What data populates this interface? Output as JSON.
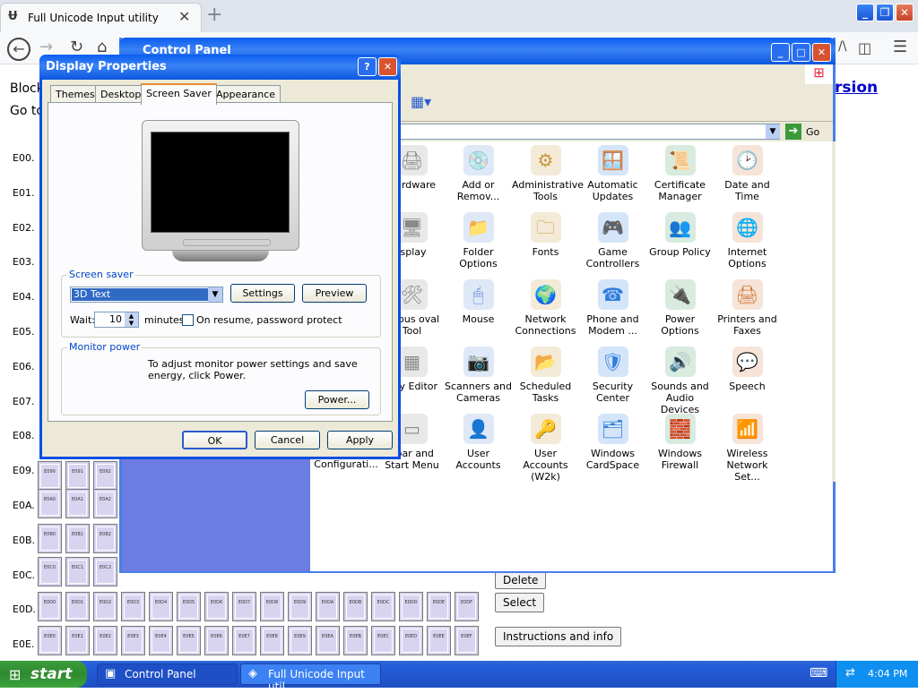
{
  "browser": {
    "tab_title": "Full Unicode Input utility",
    "tab_close": "✕",
    "new_tab": "+",
    "address_right": "/\\"
  },
  "page": {
    "left_texts": [
      "Block",
      "Go to"
    ],
    "link_right": "rsion",
    "row_labels": [
      "E00.",
      "E01.",
      "E02.",
      "E03.",
      "E04.",
      "E05.",
      "E06.",
      "E07.",
      "E08.",
      "E09.",
      "E0A.",
      "E0B.",
      "E0C.",
      "E0D.",
      "E0E."
    ],
    "cells_row_e09": [
      "E090",
      "E091",
      "E092"
    ],
    "cells_row_e0a": [
      "E0A0",
      "E0A1",
      "E0A2"
    ],
    "cells_row_e0b": [
      "E0B0",
      "E0B1",
      "E0B2"
    ],
    "cells_row_e0c": [
      "E0C0",
      "E0C1",
      "E0C2"
    ],
    "cells_row_e0d": [
      "E0D0",
      "E0D1",
      "E0D2",
      "E0D3",
      "E0D4",
      "E0D5",
      "E0D6",
      "E0D7",
      "E0D8",
      "E0D9",
      "E0DA",
      "E0DB",
      "E0DC",
      "E0DD",
      "E0DE",
      "E0DF"
    ],
    "cells_row_e0e": [
      "E0E0",
      "E0E1",
      "E0E2",
      "E0E3",
      "E0E4",
      "E0E5",
      "E0E6",
      "E0E7",
      "E0E8",
      "E0E9",
      "E0EA",
      "E0EB",
      "E0EC",
      "E0ED",
      "E0EE",
      "E0EF"
    ],
    "buttons": {
      "delete": "Delete",
      "select": "Select",
      "instructions": "Instructions and info"
    }
  },
  "control_panel": {
    "title": "Control Panel",
    "go_label": "Go",
    "items": [
      {
        "label": "Hardware",
        "icon": "hardware-icon"
      },
      {
        "label": "Add or Remov...",
        "icon": "add-remove-icon"
      },
      {
        "label": "Administrative Tools",
        "icon": "admin-tools-icon"
      },
      {
        "label": "Automatic Updates",
        "icon": "updates-icon"
      },
      {
        "label": "Certificate Manager",
        "icon": "certificate-icon"
      },
      {
        "label": "Date and Time",
        "icon": "clock-icon"
      },
      {
        "label": "isplay",
        "icon": "display-icon"
      },
      {
        "label": "Folder Options",
        "icon": "folder-options-icon"
      },
      {
        "label": "Fonts",
        "icon": "fonts-icon"
      },
      {
        "label": "Game Controllers",
        "icon": "game-controller-icon"
      },
      {
        "label": "Group Policy",
        "icon": "group-policy-icon"
      },
      {
        "label": "Internet Options",
        "icon": "internet-options-icon"
      },
      {
        "label": "licious oval Tool",
        "icon": "malicious-tool-icon"
      },
      {
        "label": "Mouse",
        "icon": "mouse-icon"
      },
      {
        "label": "Network Connections",
        "icon": "network-icon"
      },
      {
        "label": "Phone and Modem ...",
        "icon": "phone-icon"
      },
      {
        "label": "Power Options",
        "icon": "power-icon"
      },
      {
        "label": "Printers and Faxes",
        "icon": "printer-icon"
      },
      {
        "label": "stry Editor",
        "icon": "registry-icon"
      },
      {
        "label": "Scanners and Cameras",
        "icon": "scanner-icon"
      },
      {
        "label": "Scheduled Tasks",
        "icon": "scheduled-tasks-icon"
      },
      {
        "label": "Security Center",
        "icon": "shield-icon"
      },
      {
        "label": "Sounds and Audio Devices",
        "icon": "speaker-icon"
      },
      {
        "label": "Speech",
        "icon": "speech-icon"
      },
      {
        "label": "kbar and Start Menu",
        "icon": "taskbar-icon"
      },
      {
        "label": "User Accounts",
        "icon": "users-icon"
      },
      {
        "label": "User Accounts (W2k)",
        "icon": "user-w2k-icon"
      },
      {
        "label": "Windows CardSpace",
        "icon": "cardspace-icon"
      },
      {
        "label": "Windows Firewall",
        "icon": "firewall-icon"
      },
      {
        "label": "Wireless Network Set...",
        "icon": "wireless-icon"
      }
    ],
    "partial_item": "Configurati..."
  },
  "dialog": {
    "title": "Display Properties",
    "help": "?",
    "tabs": [
      "Themes",
      "Desktop",
      "Screen Saver",
      "Appearance"
    ],
    "active_tab": "Screen Saver",
    "screensaver_group": "Screen saver",
    "screensaver_value": "3D Text",
    "settings": "Settings",
    "preview": "Preview",
    "wait_label": "Wait:",
    "wait_value": "10",
    "minutes": "minutes",
    "resume_label": "On resume, password protect",
    "monitor_group": "Monitor power",
    "monitor_text": "To adjust monitor power settings and save energy, click Power.",
    "power": "Power...",
    "ok": "OK",
    "cancel": "Cancel",
    "apply": "Apply"
  },
  "taskbar": {
    "start": "start",
    "tasks": [
      "Control Panel",
      "Full Unicode Input util..."
    ],
    "clock": "4:04 PM"
  }
}
